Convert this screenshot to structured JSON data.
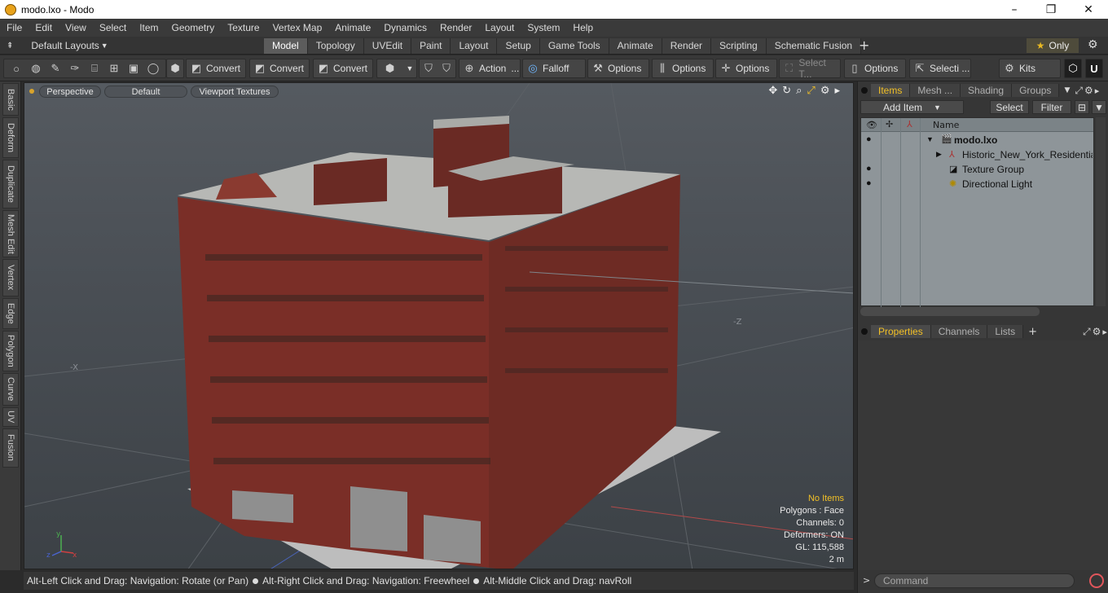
{
  "window": {
    "title": "modo.lxo - Modo",
    "controls": [
      "–",
      "❐",
      "✕"
    ]
  },
  "menu": [
    "File",
    "Edit",
    "View",
    "Select",
    "Item",
    "Geometry",
    "Texture",
    "Vertex Map",
    "Animate",
    "Dynamics",
    "Render",
    "Layout",
    "System",
    "Help"
  ],
  "layouts_label": "Default Layouts",
  "tabs": [
    "Model",
    "Topology",
    "UVEdit",
    "Paint",
    "Layout",
    "Setup",
    "Game Tools",
    "Animate",
    "Render",
    "Scripting",
    "Schematic Fusion"
  ],
  "active_tab": "Model",
  "only_label": "Only",
  "toolbar": {
    "convert1": "Convert",
    "convert2": "Convert",
    "convert3": "Convert",
    "action": "Action",
    "falloff": "Falloff",
    "options1": "Options",
    "options2": "Options",
    "options3": "Options",
    "select_t": "Select T...",
    "options4": "Options",
    "selecti": "Selecti ...",
    "kits": "Kits"
  },
  "left_tabs": [
    "Basic",
    "Deform",
    "Duplicate",
    "Mesh Edit",
    "Vertex",
    "Edge",
    "Polygon",
    "Curve",
    "UV",
    "Fusion"
  ],
  "viewport": {
    "view": "Perspective",
    "shading": "Default",
    "texture": "Viewport Textures",
    "stats": {
      "no_items": "No Items",
      "polygons": "Polygons : Face",
      "channels": "Channels: 0",
      "deformers": "Deformers: ON",
      "gl": "GL: 115,588",
      "scale": "2 m"
    },
    "axis_labels": {
      "minus_x": "-X",
      "minus_z": "-Z"
    }
  },
  "status": {
    "part1": "Alt-Left Click and Drag: Navigation: Rotate (or Pan)",
    "part2": "Alt-Right Click and Drag: Navigation: Freewheel",
    "part3": "Alt-Middle Click and Drag: navRoll"
  },
  "right_panel": {
    "top_tabs": [
      "Items",
      "Mesh ...",
      "Shading",
      "Groups"
    ],
    "add_item": "Add Item",
    "select": "Select",
    "filter": "Filter",
    "name_header": "Name",
    "tree": [
      {
        "label": "modo.lxo",
        "bold": true
      },
      {
        "label": "Historic_New_York_Residential..."
      },
      {
        "label": "Texture Group"
      },
      {
        "label": "Directional Light"
      }
    ],
    "bottom_tabs": [
      "Properties",
      "Channels",
      "Lists"
    ],
    "command_placeholder": "Command"
  }
}
